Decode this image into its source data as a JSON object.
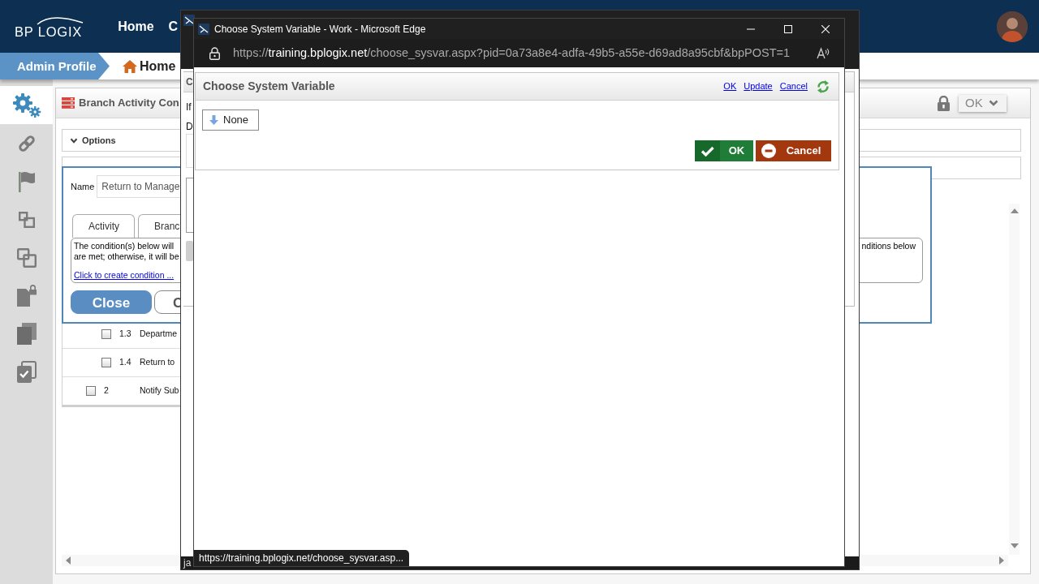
{
  "app": {
    "logo": "BP LOGIX",
    "nav": [
      {
        "label": "Home"
      },
      {
        "label": "C"
      }
    ],
    "breadcrumb": [
      {
        "label": "Admin Profile",
        "kind": "profile"
      },
      {
        "label": "Home",
        "kind": "home"
      }
    ],
    "sidebar": [
      {
        "kind": "settings",
        "selected": true
      },
      {
        "kind": "link",
        "selected": false
      },
      {
        "kind": "flag",
        "selected": false
      },
      {
        "kind": "squares",
        "selected": false
      },
      {
        "kind": "overlap",
        "selected": false
      },
      {
        "kind": "locked-document",
        "selected": false
      },
      {
        "kind": "copy",
        "selected": false
      },
      {
        "kind": "checked-copy",
        "selected": false
      }
    ],
    "panel": {
      "title": "Branch Activity Con",
      "action": "OK",
      "section": "Options",
      "editor": {
        "name_label": "Name",
        "name_value": "Return to Manage",
        "tabs": [
          {
            "label": "Activity",
            "selected": false
          },
          {
            "label": "Branc",
            "selected": false
          }
        ],
        "condition_lines": [
          "The condition(s) below will",
          "are met; otherwise, it will be"
        ],
        "condition_tail": "nditions below",
        "condition_link": "Click to create condition ...",
        "buttons": [
          {
            "label": "Close",
            "kind": "primary"
          },
          {
            "label": "C",
            "kind": "outline"
          }
        ]
      },
      "rows": [
        {
          "children": [
            {
              "number": "1.3",
              "text": "Departme",
              "checked": false
            },
            {
              "number": "1.4",
              "text": "Return to",
              "checked": false
            }
          ]
        },
        {
          "number": "2",
          "text": "Notify Sub",
          "checked": false
        }
      ]
    }
  },
  "background_window": {
    "panel_title": "C",
    "labels": [
      "If",
      "D"
    ],
    "status": "ja"
  },
  "popup_window": {
    "title": "Choose System Variable - Work - Microsoft Edge",
    "url": {
      "scheme": "https://",
      "host": "training.bplogix.net",
      "path": "/choose_sysvar.aspx?pid=0a73a8e4-adfa-49b5-a55e-d69ad8a95cbf&bpPOST=1"
    },
    "dialog": {
      "title": "Choose System Variable",
      "links": [
        "OK",
        "Update",
        "Cancel"
      ],
      "choices": [
        {
          "label": "None"
        }
      ],
      "buttons": [
        {
          "label": "OK",
          "kind": "confirm"
        },
        {
          "label": "Cancel",
          "kind": "cancel"
        }
      ]
    },
    "link_preview": "https://training.bplogix.net/choose_sysvar.asp..."
  }
}
